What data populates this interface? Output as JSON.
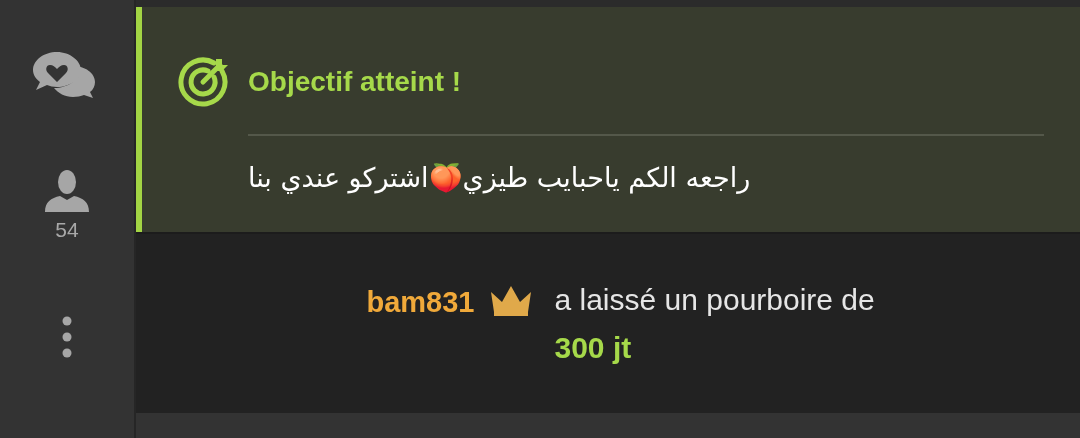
{
  "sidebar": {
    "viewer_count": "54"
  },
  "goal": {
    "title": "Objectif atteint !",
    "message": "راجعه الكم ياحبايب طيزي🍑اشتركو عندي بنا"
  },
  "tip": {
    "username": "bam831",
    "crowned": true,
    "message": "a laissé un pourboire de **300 jt**"
  }
}
